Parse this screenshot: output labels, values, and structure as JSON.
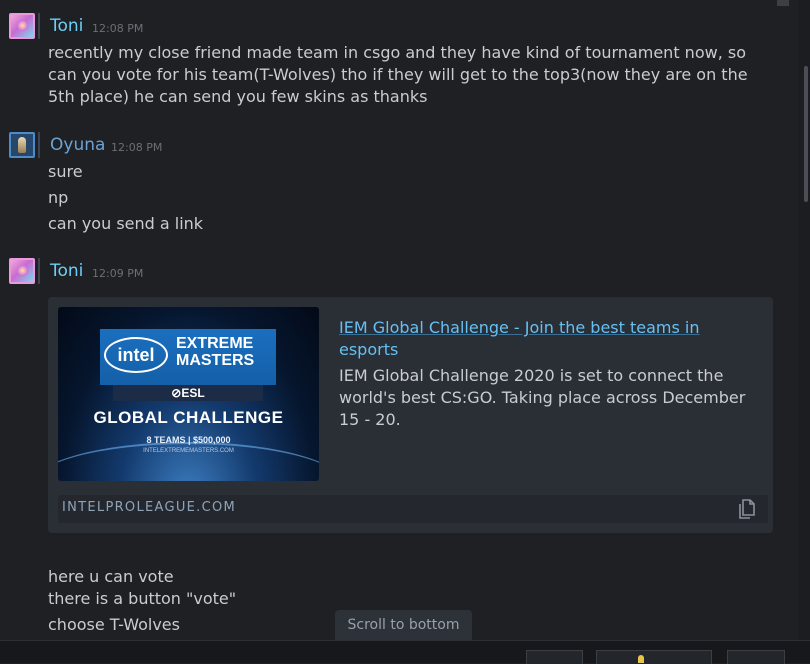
{
  "messages": [
    {
      "user": "Toni",
      "time": "12:08 PM",
      "lines": [
        "recently my close friend made team in csgo and they have kind of tournament now, so",
        "can you vote for his team(T-Wolves) tho if they will get to the top3(now they are on the",
        "5th place) he can send you few skins as thanks"
      ]
    },
    {
      "user": "Oyuna",
      "time": "12:08 PM",
      "lines": [
        "sure",
        "np",
        "can you send a link"
      ]
    },
    {
      "user": "Toni",
      "time": "12:09 PM",
      "embed": {
        "thumbnail": {
          "brand": "intel",
          "line1": "EXTREME",
          "line2": "MASTERS",
          "esl": "⊘ESL",
          "headline": "GLOBAL CHALLENGE",
          "teams": "8 TEAMS | $500,000",
          "url": "INTELEXTREMEMASTERS.COM"
        },
        "title_lines": [
          "IEM Global Challenge - Join the best teams in",
          "esports"
        ],
        "description_lines": [
          "IEM Global Challenge 2020 is set to connect the",
          "world's best CS:GO. Taking place across December",
          "15 - 20."
        ],
        "domain": "INTELPROLEAGUE.COM",
        "copy_icon": "copy-icon"
      },
      "lines": [
        "here u can vote",
        "there is a button \"vote\"",
        "choose T-Wolves"
      ]
    }
  ],
  "scroll_to_bottom_label": "Scroll to bottom",
  "colors": {
    "background": "#1e2024",
    "username_toni": "#6dcff6",
    "username_oyuna": "#6ba3d6",
    "link": "#66c0f4"
  }
}
